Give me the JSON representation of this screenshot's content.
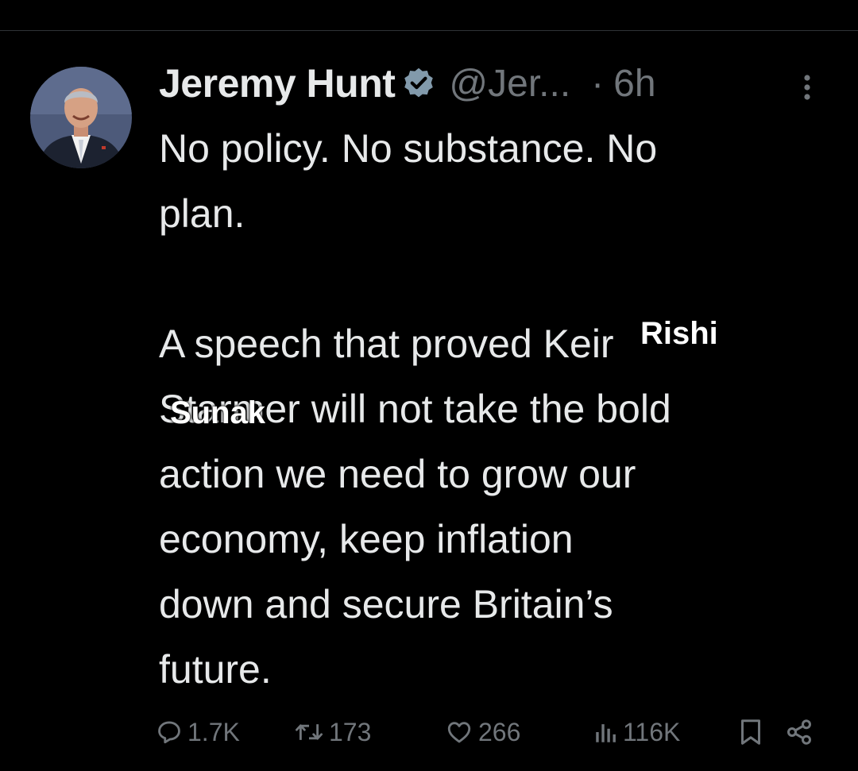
{
  "tweet": {
    "author_name": "Jeremy Hunt",
    "handle": "@Jer...",
    "separator": "·",
    "time": "6h",
    "lines": [
      "No policy. No substance. No",
      "plan.",
      "",
      "A speech that proved Keir",
      "Starmer will not take the bold",
      "action we need to grow our",
      "economy, keep inflation",
      "down and secure Britain’s",
      "future."
    ],
    "overlay_top": "Rishi",
    "overlay_bottom": "Sunak"
  },
  "actions": {
    "replies": "1.7K",
    "retweets": "173",
    "likes": "266",
    "views": "116K"
  },
  "icons": {
    "verified": "verified-badge-icon",
    "more": "more-options-icon",
    "reply": "reply-icon",
    "retweet": "retweet-icon",
    "like": "heart-icon",
    "views": "views-icon",
    "bookmark": "bookmark-icon",
    "share": "share-icon"
  },
  "colors": {
    "background": "#000000",
    "text": "#e7e9ea",
    "secondary": "#71767b",
    "verified_badge": "#829aab",
    "divider": "#2f3336"
  }
}
